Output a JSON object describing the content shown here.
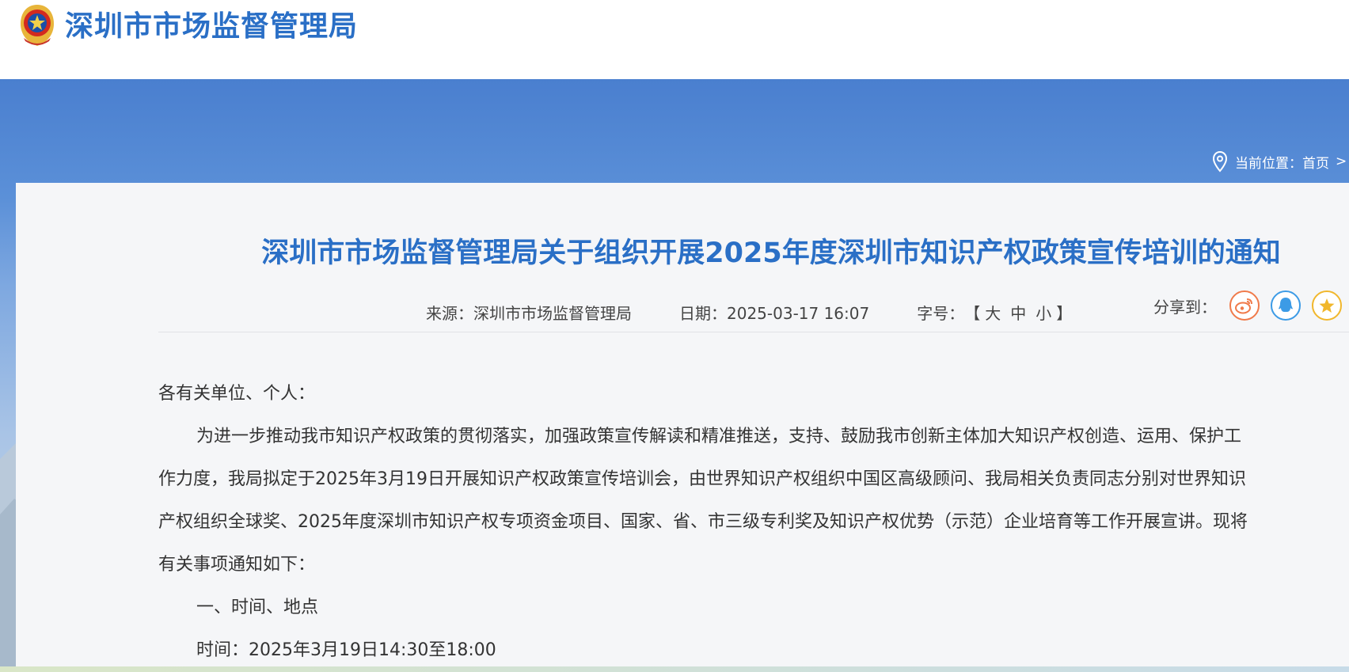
{
  "header": {
    "site_title": "深圳市市场监督管理局"
  },
  "breadcrumb": {
    "label": "当前位置：",
    "home": "首页",
    "separator": ">"
  },
  "article": {
    "title": "深圳市市场监督管理局关于组织开展2025年度深圳市知识产权政策宣传培训的通知",
    "meta": {
      "source": "来源：深圳市市场监督管理局",
      "date": "日期：2025-03-17 16:07",
      "fontsize_label": "字号：",
      "fontsize_open": "【",
      "fontsize_large": "大",
      "fontsize_medium": "中",
      "fontsize_small": "小",
      "fontsize_close": "】"
    },
    "share": {
      "label": "分享到：",
      "buttons": [
        "weibo-icon",
        "qq-icon",
        "favorite-star-icon"
      ]
    },
    "body": {
      "salutation": "各有关单位、个人：",
      "para1_line1": "为进一步推动我市知识产权政策的贯彻落实，加强政策宣传解读和精准推送，支持、鼓励我市创新主体加大知识产权创造、运用、保护工",
      "para1_line2": "作力度，我局拟定于2025年3月19日开展知识产权政策宣传培训会，由世界知识产权组织中国区高级顾问、我局相关负责同志分别对世界知识",
      "para1_line3": "产权组织全球奖、2025年度深圳市知识产权专项资金项目、国家、省、市三级专利奖及知识产权优势（示范）企业培育等工作开展宣讲。现将",
      "para1_line4": "有关事项通知如下：",
      "section1_heading": "一、时间、地点",
      "time_line": "时间：2025年3月19日14:30至18:00"
    }
  },
  "colors": {
    "brand_blue": "#2a6fc6",
    "banner_top": "#4a7fcf",
    "card_bg": "#f5f6f8",
    "weibo": "#f07a4a",
    "qq": "#3c9be6",
    "favorite": "#f1b72c"
  }
}
